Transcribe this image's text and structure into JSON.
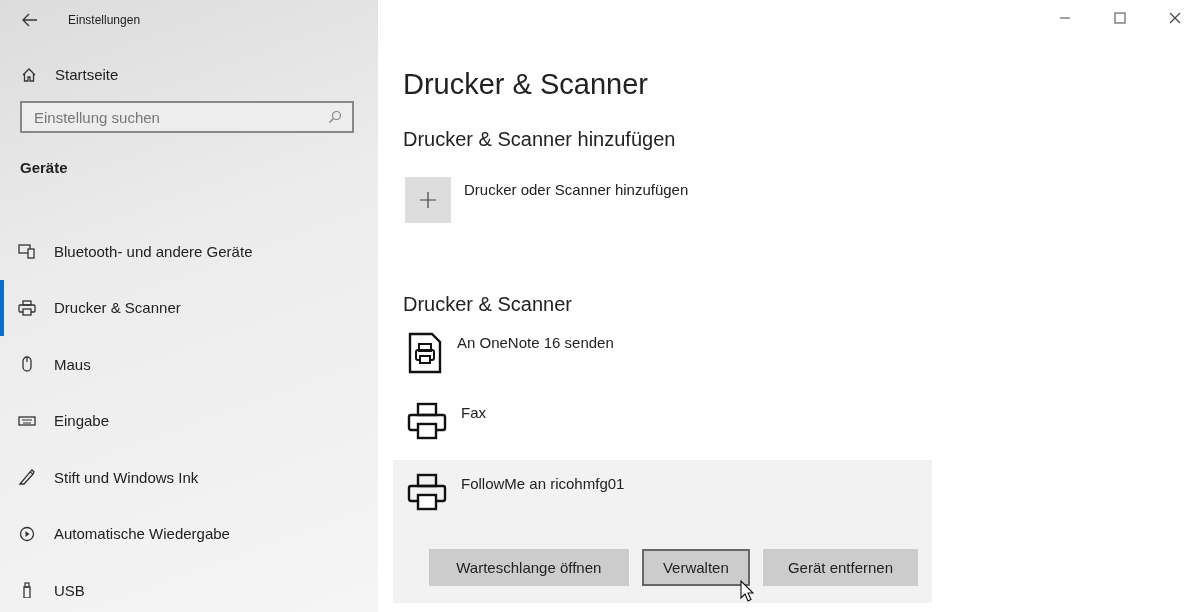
{
  "window": {
    "title": "Einstellungen"
  },
  "sidebar": {
    "home": "Startseite",
    "search": {
      "placeholder": "Einstellung suchen"
    },
    "section": "Geräte",
    "items": [
      {
        "label": "Bluetooth- und andere Geräte",
        "selected": false
      },
      {
        "label": "Drucker & Scanner",
        "selected": true
      },
      {
        "label": "Maus",
        "selected": false
      },
      {
        "label": "Eingabe",
        "selected": false
      },
      {
        "label": "Stift und Windows Ink",
        "selected": false
      },
      {
        "label": "Automatische Wiedergabe",
        "selected": false
      },
      {
        "label": "USB",
        "selected": false
      }
    ]
  },
  "main": {
    "title": "Drucker & Scanner",
    "add_heading": "Drucker & Scanner hinzufügen",
    "add_label": "Drucker oder Scanner hinzufügen",
    "list_heading": "Drucker & Scanner",
    "printers": [
      {
        "name": "An OneNote 16 senden",
        "kind": "document",
        "selected": false
      },
      {
        "name": "Fax",
        "kind": "printer",
        "selected": false
      },
      {
        "name": "FollowMe an ricohmfg01",
        "kind": "printer",
        "selected": true,
        "buttons": [
          {
            "label": "Warteschlange öffnen",
            "focused": false
          },
          {
            "label": "Verwalten",
            "focused": true
          },
          {
            "label": "Gerät entfernen",
            "focused": false
          }
        ]
      }
    ]
  }
}
